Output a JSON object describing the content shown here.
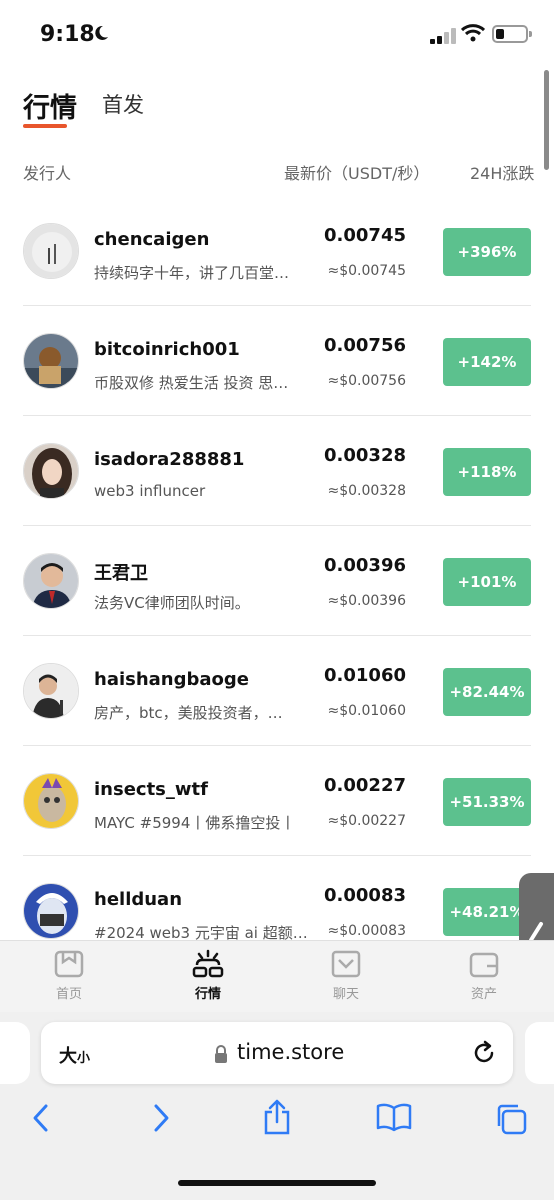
{
  "status": {
    "time": "9:18"
  },
  "tabs": {
    "active": "行情",
    "second": "首发"
  },
  "columns": {
    "issuer": "发行人",
    "price": "最新价（USDT/秒）",
    "change": "24H涨跌"
  },
  "rows": [
    {
      "name": "chencaigen",
      "desc": "持续码字十年，讲了几百堂…",
      "price": "0.00745",
      "usd": "≈$0.00745",
      "change": "+396%"
    },
    {
      "name": "bitcoinrich001",
      "desc": "币股双修 热爱生活 投资 思…",
      "price": "0.00756",
      "usd": "≈$0.00756",
      "change": "+142%"
    },
    {
      "name": "isadora288881",
      "desc": "web3 influncer",
      "price": "0.00328",
      "usd": "≈$0.00328",
      "change": "+118%"
    },
    {
      "name": "王君卫",
      "desc": "法务VC律师团队时间。",
      "price": "0.00396",
      "usd": "≈$0.00396",
      "change": "+101%"
    },
    {
      "name": "haishangbaoge",
      "desc": "房产，btc，美股投资者，…",
      "price": "0.01060",
      "usd": "≈$0.01060",
      "change": "+82.44%"
    },
    {
      "name": "insects_wtf",
      "desc": "MAYC #5994丨佛系撸空投丨",
      "price": "0.00227",
      "usd": "≈$0.00227",
      "change": "+51.33%"
    },
    {
      "name": "hellduan",
      "desc": "#2024 web3 元宇宙 ai 超额…",
      "price": "0.00083",
      "usd": "≈$0.00083",
      "change": "+48.21%"
    }
  ],
  "tabbar": {
    "home": "首页",
    "market": "行情",
    "chat": "聊天",
    "assets": "资产"
  },
  "browser": {
    "text_size_big": "大",
    "text_size_small": "小",
    "url": "time.store"
  },
  "colors": {
    "accent": "#e8552c",
    "up": "#5cc18e"
  },
  "icons": [
    "moon-icon",
    "signal-icon",
    "wifi-icon",
    "battery-icon",
    "lock-icon",
    "reload-icon",
    "back-icon",
    "forward-icon",
    "share-icon",
    "bookmarks-icon",
    "tabs-icon"
  ]
}
